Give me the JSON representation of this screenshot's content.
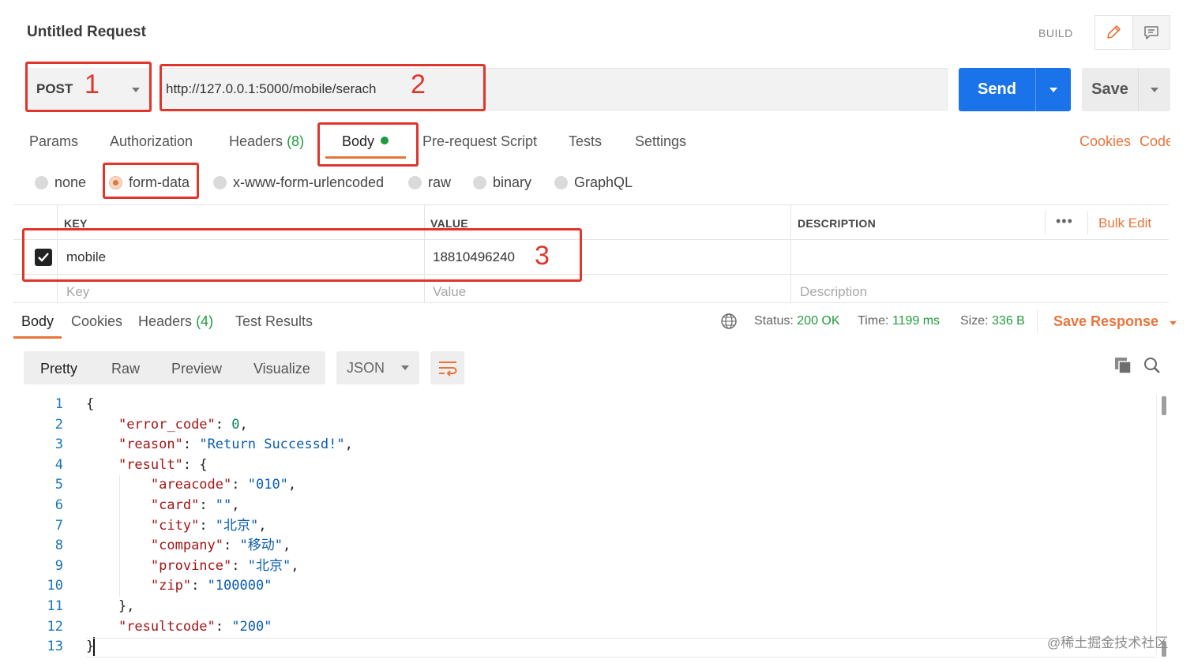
{
  "header": {
    "title": "Untitled Request",
    "build_label": "BUILD",
    "icons": [
      "pencil-icon",
      "comment-icon"
    ]
  },
  "request": {
    "method": "POST",
    "url": "http://127.0.0.1:5000/mobile/serach",
    "send_label": "Send",
    "save_label": "Save"
  },
  "request_tabs": {
    "params": "Params",
    "authorization": "Authorization",
    "headers": "Headers",
    "headers_count": "(8)",
    "body": "Body",
    "pre_request": "Pre-request Script",
    "tests": "Tests",
    "settings": "Settings",
    "cookies": "Cookies",
    "code": "Code",
    "active": "Body"
  },
  "body_types": {
    "none": "none",
    "form_data": "form-data",
    "urlencoded": "x-www-form-urlencoded",
    "raw": "raw",
    "binary": "binary",
    "graphql": "GraphQL",
    "selected": "form-data"
  },
  "params_table": {
    "headers": {
      "key": "KEY",
      "value": "VALUE",
      "description": "DESCRIPTION"
    },
    "bulk_edit": "Bulk Edit",
    "rows": [
      {
        "checked": true,
        "key": "mobile",
        "value": "18810496240",
        "description": ""
      }
    ],
    "placeholders": {
      "key": "Key",
      "value": "Value",
      "description": "Description"
    }
  },
  "response": {
    "tabs": {
      "body": "Body",
      "cookies": "Cookies",
      "headers": "Headers",
      "headers_count": "(4)",
      "test_results": "Test Results"
    },
    "status_label": "Status:",
    "status_value": "200 OK",
    "time_label": "Time:",
    "time_value": "1199 ms",
    "size_label": "Size:",
    "size_value": "336 B",
    "save_response": "Save Response",
    "views": {
      "pretty": "Pretty",
      "raw": "Raw",
      "preview": "Preview",
      "visualize": "Visualize"
    },
    "format": "JSON",
    "line_numbers": [
      "1",
      "2",
      "3",
      "4",
      "5",
      "6",
      "7",
      "8",
      "9",
      "10",
      "11",
      "12",
      "13"
    ],
    "body_json": {
      "error_code": "0",
      "reason": "\"Return Successd!\"",
      "areacode": "\"010\"",
      "card": "\"\"",
      "city": "\"北京\"",
      "company": "\"移动\"",
      "province": "\"北京\"",
      "zip": "\"100000\"",
      "resultcode": "\"200\""
    }
  },
  "annotations": {
    "one": "1",
    "two": "2",
    "three": "3"
  },
  "watermark": "@稀土掘金技术社区",
  "colors": {
    "accent": "#e8743b",
    "send_blue": "#1a73e8",
    "status_green": "#1f9b3d",
    "annotation_red": "#e0352b"
  }
}
